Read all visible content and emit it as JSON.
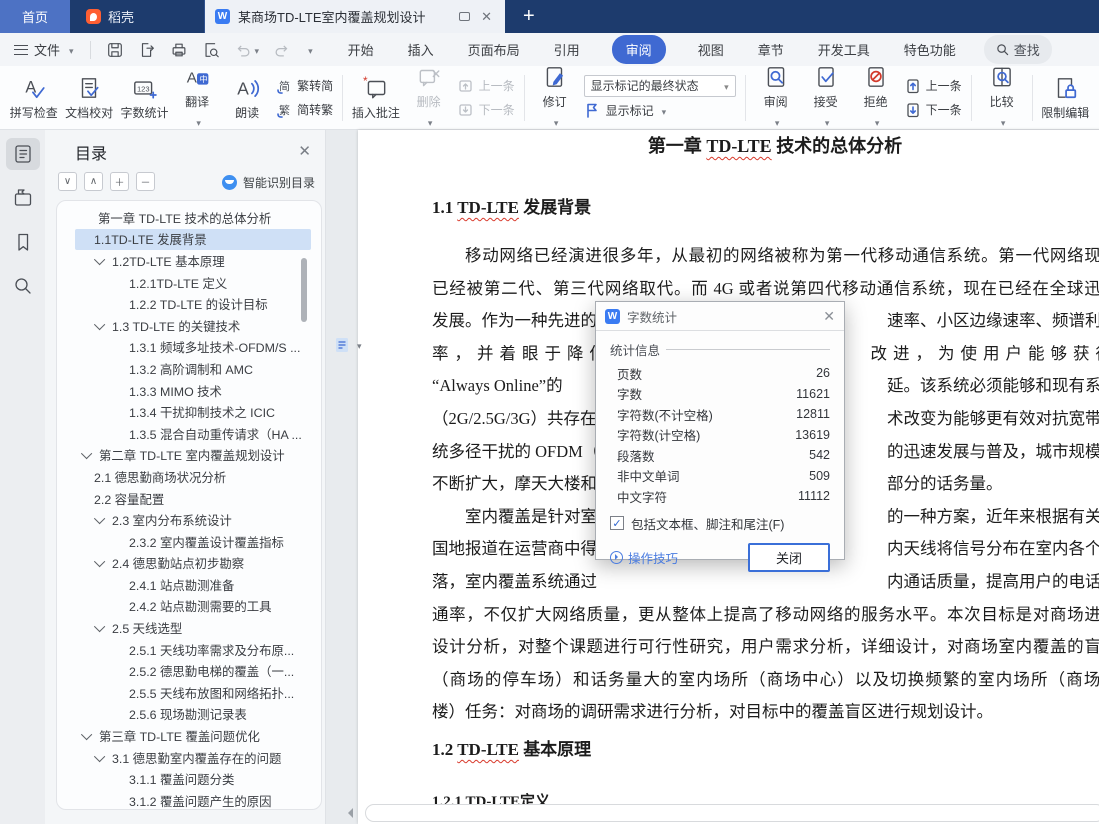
{
  "colors": {
    "accent": "#3f69d2",
    "topbar": "#1d3b6d",
    "selection": "#cfe0f6",
    "misspell_underline": "#d8392b"
  },
  "tabbar": {
    "home": "首页",
    "docer": "稻壳",
    "document": "某商场TD-LTE室内覆盖规划设计",
    "doc_icon_letter": "W",
    "new_tab": "+"
  },
  "menu": {
    "file": "文件",
    "tabs": [
      "开始",
      "插入",
      "页面布局",
      "引用",
      "审阅",
      "视图",
      "章节",
      "开发工具",
      "特色功能"
    ],
    "active_tab": "审阅",
    "find": "查找"
  },
  "ribbon": {
    "spell_check": "拼写检查",
    "doc_proof": "文档校对",
    "word_count": "字数统计",
    "translate": "翻译",
    "read_aloud": "朗读",
    "trad_to_simp": "繁转简",
    "simp_to_trad": "简转繁",
    "insert_comment": "插入批注",
    "delete_comment": "删除",
    "prev_comment": "上一条",
    "next_comment": "下一条",
    "track_changes": "修订",
    "markup_state": "显示标记的最终状态",
    "show_markup": "显示标记",
    "review": "审阅",
    "accept": "接受",
    "reject": "拒绝",
    "prev_change": "上一条",
    "next_change": "下一条",
    "compare": "比较",
    "restrict_edit": "限制编辑"
  },
  "sidebar": {
    "title": "目录",
    "smart_toc": "智能识别目录",
    "items": [
      {
        "text": "第一章 TD-LTE 技术的总体分析",
        "level": 1,
        "chevron": false,
        "selected": false
      },
      {
        "text": "1.1TD-LTE 发展背景",
        "level": 2,
        "chevron": false,
        "selected": true
      },
      {
        "text": "1.2TD-LTE 基本原理",
        "level": 2,
        "chevron": true,
        "selected": false
      },
      {
        "text": "1.2.1TD-LTE 定义",
        "level": 3,
        "chevron": false,
        "selected": false
      },
      {
        "text": "1.2.2 TD-LTE 的设计目标",
        "level": 3,
        "chevron": false,
        "selected": false
      },
      {
        "text": "1.3 TD-LTE 的关键技术",
        "level": 2,
        "chevron": true,
        "selected": false
      },
      {
        "text": "1.3.1 频域多址技术-OFDM/S ...",
        "level": 3,
        "chevron": false,
        "selected": false
      },
      {
        "text": "1.3.2 高阶调制和 AMC",
        "level": 3,
        "chevron": false,
        "selected": false
      },
      {
        "text": "1.3.3 MIMO 技术",
        "level": 3,
        "chevron": false,
        "selected": false
      },
      {
        "text": "1.3.4 干扰抑制技术之 ICIC",
        "level": 3,
        "chevron": false,
        "selected": false
      },
      {
        "text": "1.3.5 混合自动重传请求（HA ...",
        "level": 3,
        "chevron": false,
        "selected": false
      },
      {
        "text": "第二章 TD-LTE 室内覆盖规划设计",
        "level": 1,
        "chevron": true,
        "selected": false
      },
      {
        "text": "2.1 德思勤商场状况分析",
        "level": 2,
        "chevron": false,
        "selected": false
      },
      {
        "text": "2.2 容量配置",
        "level": 2,
        "chevron": false,
        "selected": false
      },
      {
        "text": "2.3 室内分布系统设计",
        "level": 2,
        "chevron": true,
        "selected": false
      },
      {
        "text": "2.3.2 室内覆盖设计覆盖指标",
        "level": 3,
        "chevron": false,
        "selected": false
      },
      {
        "text": "2.4 德思勤站点初步勘察",
        "level": 2,
        "chevron": true,
        "selected": false
      },
      {
        "text": "2.4.1 站点勘测准备",
        "level": 3,
        "chevron": false,
        "selected": false
      },
      {
        "text": "2.4.2 站点勘测需要的工具",
        "level": 3,
        "chevron": false,
        "selected": false
      },
      {
        "text": "2.5 天线选型",
        "level": 2,
        "chevron": true,
        "selected": false
      },
      {
        "text": "2.5.1 天线功率需求及分布原...",
        "level": 3,
        "chevron": false,
        "selected": false
      },
      {
        "text": "2.5.2 德思勤电梯的覆盖（一...",
        "level": 3,
        "chevron": false,
        "selected": false
      },
      {
        "text": "2.5.5 天线布放图和网络拓扑...",
        "level": 3,
        "chevron": false,
        "selected": false
      },
      {
        "text": "2.5.6 现场勘测记录表",
        "level": 3,
        "chevron": false,
        "selected": false
      },
      {
        "text": "第三章 TD-LTE 覆盖问题优化",
        "level": 1,
        "chevron": true,
        "selected": false
      },
      {
        "text": "3.1 德思勤室内覆盖存在的问题",
        "level": 2,
        "chevron": true,
        "selected": false
      },
      {
        "text": "3.1.1 覆盖问题分类",
        "level": 3,
        "chevron": false,
        "selected": false
      },
      {
        "text": "3.1.2 覆盖问题产生的原因",
        "level": 3,
        "chevron": false,
        "selected": false
      }
    ]
  },
  "doc": {
    "headings": {
      "h1_pre": "第一章 ",
      "h1_mark": "TD-LTE",
      "h1_suf": " 技术的总体分析",
      "h2_pre": "1.1 ",
      "h2_mark": "TD-LTE",
      "h2_suf": " 发展背景",
      "h3_pre": "1.2 ",
      "h3_mark": "TD-LTE",
      "h3_suf": " 基本原理",
      "h4_pre": "1.2.1 ",
      "h4_mark": "TD-LTE",
      "h4_suf": "定义"
    },
    "lines": [
      {
        "left": "移动网络已经演进很多年，从最初的网络被称为第一代移动通信系统。第一代网络现在",
        "indent": true,
        "just": true
      },
      {
        "left": "已经被第二代、第三代网络取代。而 4G 或者说第四代移动通信系统，现在已经在全球迅猛",
        "just": true
      },
      {
        "left": "发展。作为一种先进的",
        "right": "速率、小区边缘速率、频谱利用"
      },
      {
        "left": "率，并着眼于降低",
        "right": "改进，为使用户能够获得",
        "spread": true
      },
      {
        "left": "“Always Online”的",
        "right": "延。该系统必须能够和现有系统"
      },
      {
        "left": "（2G/2.5G/3G）共存在",
        "right": "术改变为能够更有效对抗宽带系"
      },
      {
        "left": "统多径干扰的 OFDM（正",
        "right": "的迅速发展与普及，城市规模的"
      },
      {
        "left": "不断扩大，摩天大楼和",
        "right": "部分的话务量。",
        "rleft": 455
      },
      {
        "left": "室内覆盖是针对室",
        "right": "的一种方案，近年来根据有关全",
        "indent": true
      },
      {
        "left": "国地报道在运营商中得",
        "right": "内天线将信号分布在室内各个角"
      },
      {
        "left": "落，室内覆盖系统通过",
        "right": "内通话质量，提高用户的电话接"
      },
      {
        "left": "通率，不仅扩大网络质量，更从整体上提高了移动网络的服务水平。本次目标是对商场进行",
        "just": true
      },
      {
        "left": "设计分析，对整个课题进行可行性研究，用户需求分析，详细设计，对商场室内覆盖的盲区",
        "just": true
      },
      {
        "left": "（商场的停车场）和话务量大的室内场所（商场中心）以及切换频繁的室内场所（商场顶",
        "just": true
      },
      {
        "left": "楼）任务：对商场的调研需求进行分析，对目标中的覆盖盲区进行规划设计。"
      }
    ]
  },
  "dialog": {
    "title": "字数统计",
    "icon_letter": "W",
    "section": "统计信息",
    "stats": [
      {
        "label": "页数",
        "value": "26"
      },
      {
        "label": "字数",
        "value": "11621"
      },
      {
        "label": "字符数(不计空格)",
        "value": "12811"
      },
      {
        "label": "字符数(计空格)",
        "value": "13619"
      },
      {
        "label": "段落数",
        "value": "542"
      },
      {
        "label": "非中文单词",
        "value": "509"
      },
      {
        "label": "中文字符",
        "value": "11112"
      }
    ],
    "checkbox_label": "包括文本框、脚注和尾注(F)",
    "checkbox_checked": true,
    "tips": "操作技巧",
    "close": "关闭"
  }
}
